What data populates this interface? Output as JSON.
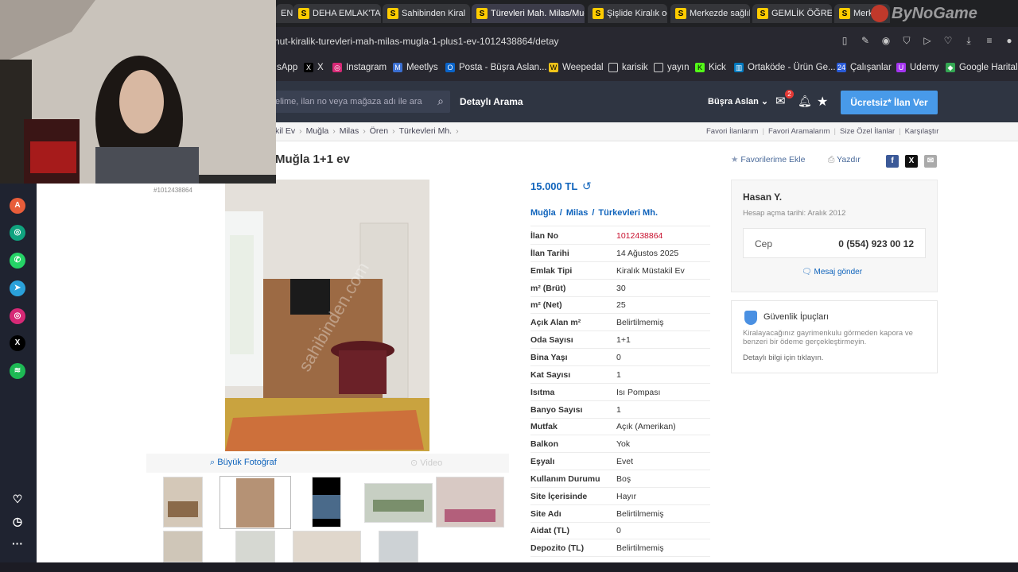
{
  "tabs": [
    {
      "label": "ENK"
    },
    {
      "label": "DEHA EMLAK'TA"
    },
    {
      "label": "Sahibinden Kiral"
    },
    {
      "label": "Türevleri Mah. Milas/Muğ"
    },
    {
      "label": "Şişlide Kiralık oda"
    },
    {
      "label": "Merkezde sağlık"
    },
    {
      "label": "GEMLİK ÖĞRENC"
    },
    {
      "label": "Merke"
    }
  ],
  "watermark": "ByNoGame",
  "url": "nut-kiralik-turevleri-mah-milas-mugla-1-plus1-ev-1012438864/detay",
  "bookmarks": [
    {
      "label": "sApp"
    },
    {
      "label": "X"
    },
    {
      "label": "Instagram"
    },
    {
      "label": "Meetlys"
    },
    {
      "label": "Posta - Büşra Aslan..."
    },
    {
      "label": "Weepedal"
    },
    {
      "label": "karisik"
    },
    {
      "label": "yayın"
    },
    {
      "label": "Kick"
    },
    {
      "label": "Ortaköde - Ürün Ge..."
    },
    {
      "label": "Çalışanlar"
    },
    {
      "label": "Udemy"
    },
    {
      "label": "Google Haritalar"
    }
  ],
  "header": {
    "search_placeholder": "elime, ilan no veya mağaza adı ile ara",
    "detailed_search": "Detaylı Arama",
    "user_name": "Büşra Aslan",
    "mail_badge": "2",
    "post_button": "Ücretsiz* İlan Ver"
  },
  "breadcrumb": [
    "kil Ev",
    "Muğla",
    "Milas",
    "Ören",
    "Türkevleri Mh."
  ],
  "top_links": [
    "Favori İlanlarım",
    "Favori Aramalarım",
    "Size Özel İlanlar",
    "Karşılaştır"
  ],
  "listing": {
    "title": "Muğla 1+1 ev",
    "id_tag": "#1012438864",
    "favorite_label": "Favorilerime Ekle",
    "print_label": "Yazdır",
    "price": "15.000 TL",
    "location": [
      "Muğla",
      "Milas",
      "Türkevleri Mh."
    ],
    "photo_watermark": "sahibinden.com",
    "big_photo_label": "Büyük Fotoğraf",
    "video_label": "Video"
  },
  "details": [
    {
      "label": "İlan No",
      "value": "1012438864",
      "highlight": true
    },
    {
      "label": "İlan Tarihi",
      "value": "14 Ağustos 2025"
    },
    {
      "label": "Emlak Tipi",
      "value": "Kiralık Müstakil Ev"
    },
    {
      "label": "m² (Brüt)",
      "value": "30"
    },
    {
      "label": "m² (Net)",
      "value": "25"
    },
    {
      "label": "Açık Alan m²",
      "value": "Belirtilmemiş"
    },
    {
      "label": "Oda Sayısı",
      "value": "1+1"
    },
    {
      "label": "Bina Yaşı",
      "value": "0"
    },
    {
      "label": "Kat Sayısı",
      "value": "1"
    },
    {
      "label": "Isıtma",
      "value": "Isı Pompası"
    },
    {
      "label": "Banyo Sayısı",
      "value": "1"
    },
    {
      "label": "Mutfak",
      "value": "Açık (Amerikan)"
    },
    {
      "label": "Balkon",
      "value": "Yok"
    },
    {
      "label": "Eşyalı",
      "value": "Evet"
    },
    {
      "label": "Kullanım Durumu",
      "value": "Boş"
    },
    {
      "label": "Site İçerisinde",
      "value": "Hayır"
    },
    {
      "label": "Site Adı",
      "value": "Belirtilmemiş"
    },
    {
      "label": "Aidat (TL)",
      "value": "0"
    },
    {
      "label": "Depozito (TL)",
      "value": "Belirtilmemiş"
    }
  ],
  "seller": {
    "name": "Hasan Y.",
    "since": "Hesap açma tarihi: Aralık 2012",
    "phone_label": "Cep",
    "phone": "0 (554) 923 00 12",
    "message_label": "Mesaj gönder"
  },
  "safety": {
    "title": "Güvenlik İpuçları",
    "text": "Kiralayacağınız gayrimenkulu görmeden kapora ve benzeri bir ödeme gerçekleştirmeyin.",
    "link_text": "Detaylı bilgi için tıklayın."
  },
  "colors": {
    "header_bg": "#2f3542",
    "accent_blue": "#489ae9",
    "link_blue": "#1064bc",
    "id_red": "#c8102e"
  }
}
